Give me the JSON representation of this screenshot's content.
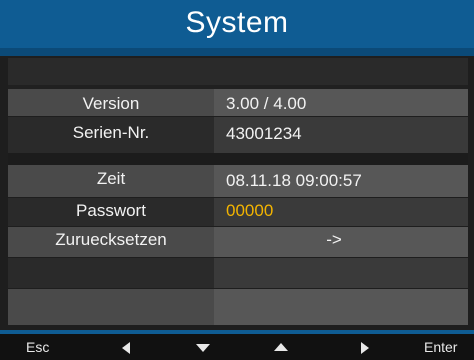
{
  "title": "System",
  "rows": [
    {
      "label": "",
      "value": ""
    },
    {
      "label": "Version",
      "value": "3.00 / 4.00"
    },
    {
      "label": "Serien-Nr.",
      "value": "43001234"
    },
    {
      "label": "Zeit",
      "value": "08.11.18  09:00:57"
    },
    {
      "label": "Passwort",
      "value": "00000"
    },
    {
      "label": "Zuruecksetzen",
      "value": "->"
    },
    {
      "label": "",
      "value": ""
    },
    {
      "label": "",
      "value": ""
    }
  ],
  "colors": {
    "title_bg": "#0f5c93",
    "password_value": "#f3b400"
  },
  "footer": {
    "esc": "Esc",
    "enter": "Enter",
    "icons": [
      "left-arrow-icon",
      "down-arrow-icon",
      "up-arrow-icon",
      "right-arrow-icon"
    ]
  }
}
